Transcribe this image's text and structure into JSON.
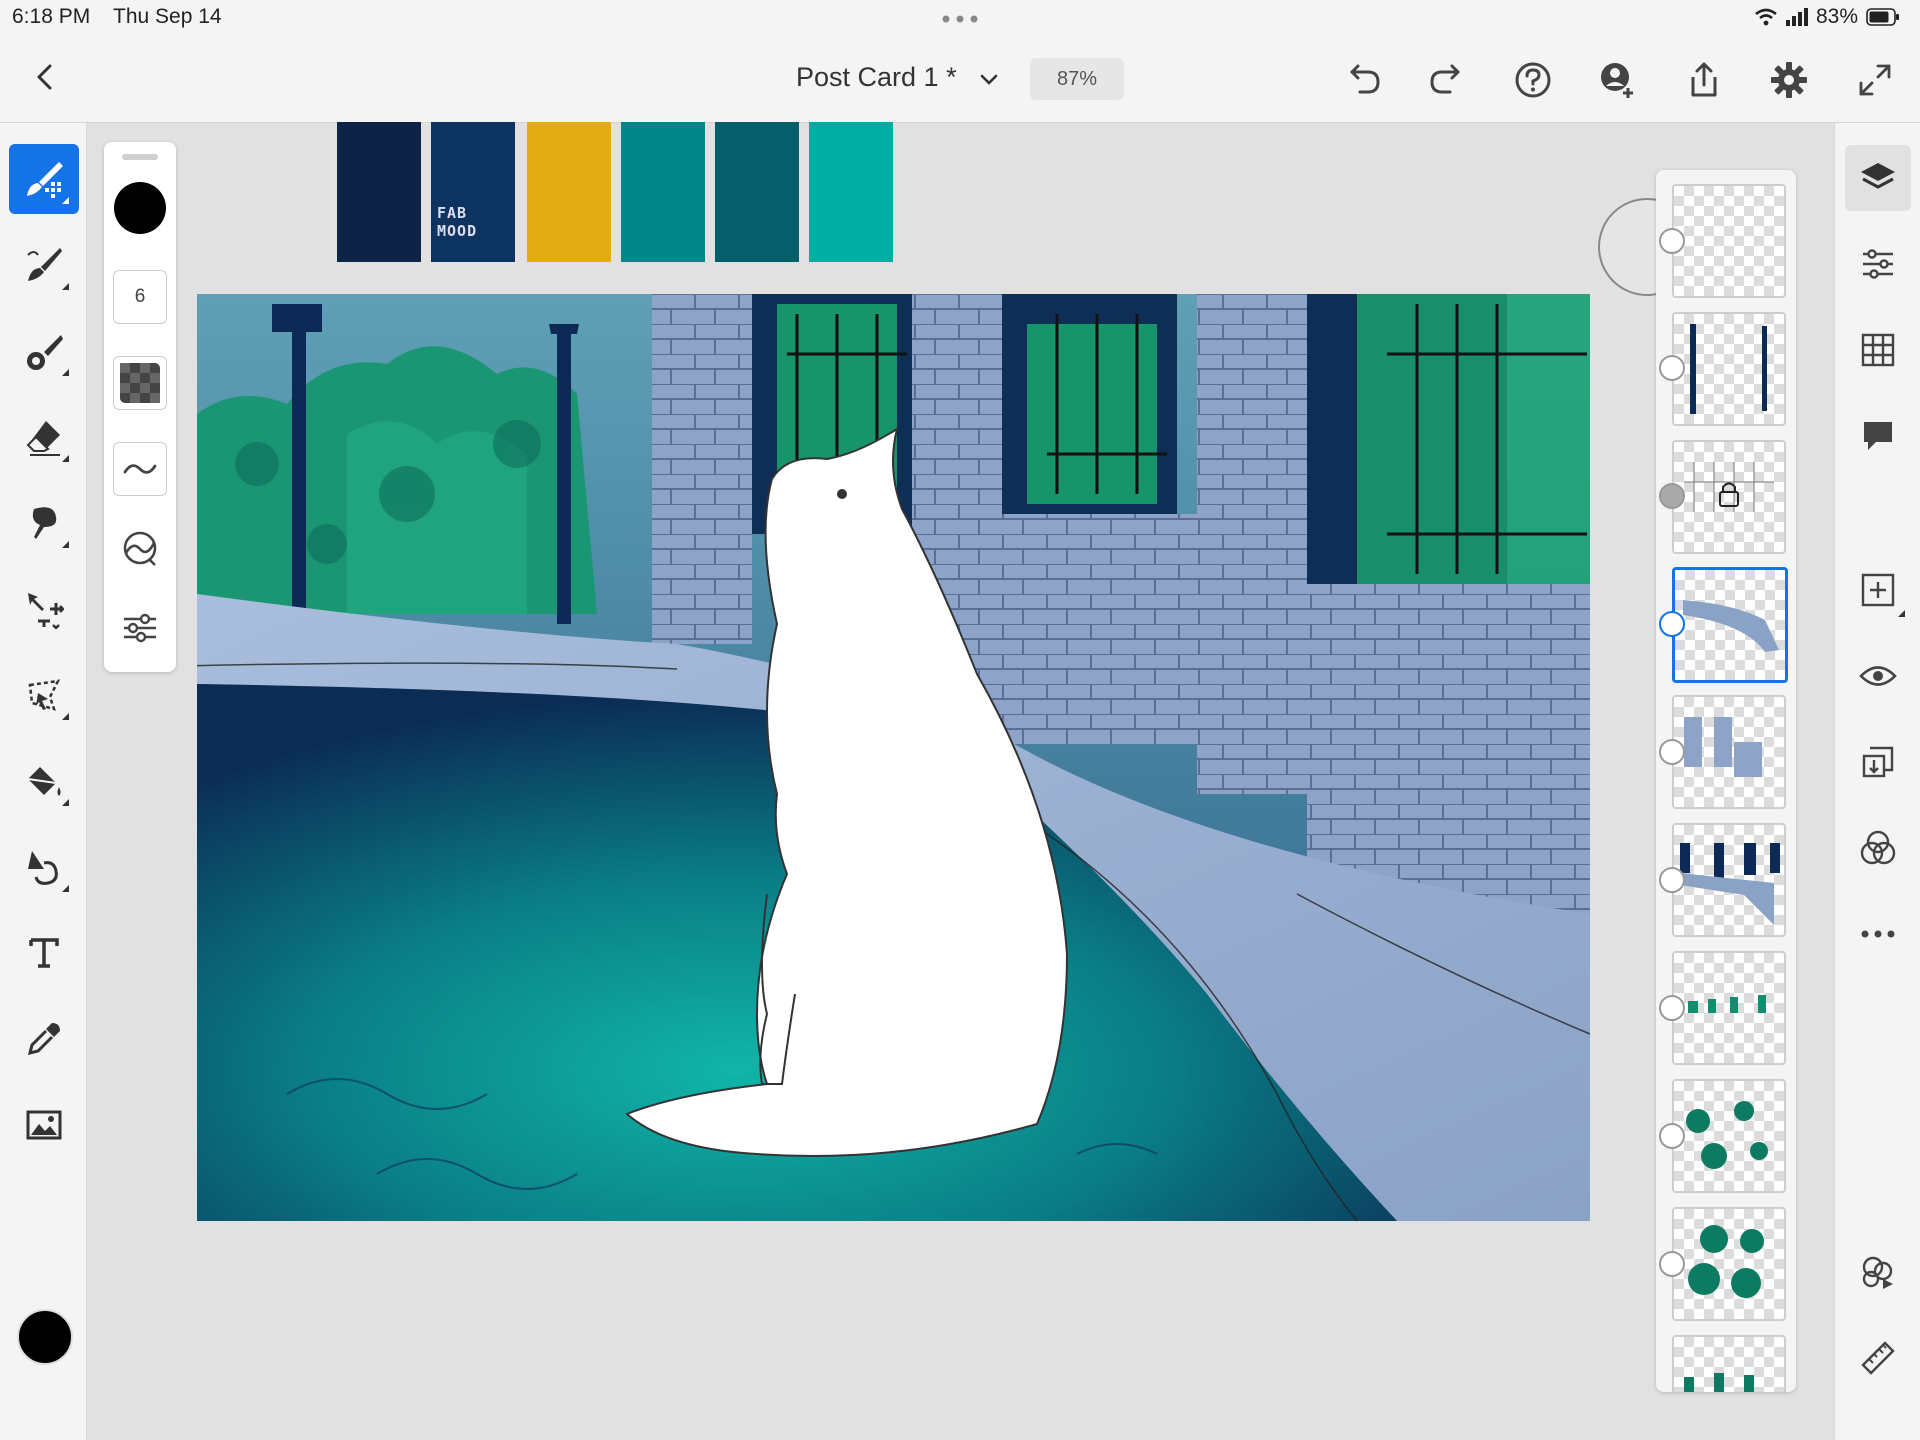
{
  "status": {
    "time": "6:18 PM",
    "date": "Thu Sep 14",
    "battery": "83%"
  },
  "document": {
    "title": "Post Card 1 *",
    "zoom": "87%"
  },
  "brush": {
    "size": "6"
  },
  "palette": {
    "swatches": [
      "#0d2447",
      "#0d3360",
      "#e3ab14",
      "#01878a",
      "#055f6b",
      "#00ada3"
    ],
    "swatch_text": "FAB MOOD"
  },
  "colors": {
    "accent": "#1473e6",
    "current_color": "#000000"
  },
  "toolbar_icons": [
    "undo-icon",
    "redo-icon",
    "help-icon",
    "invite-icon",
    "share-icon",
    "settings-icon",
    "fullscreen-icon"
  ],
  "left_tools": [
    "pixel-brush-icon",
    "live-brush-icon",
    "vector-brush-icon",
    "eraser-icon",
    "smudge-icon",
    "transform-icon",
    "lasso-icon",
    "fill-icon",
    "liquify-icon",
    "text-icon",
    "eyedropper-icon",
    "image-icon"
  ],
  "right_tools": [
    "layers-icon",
    "layer-properties-icon",
    "grid-icon",
    "comments-icon",
    "add-layer-icon",
    "visibility-icon",
    "merge-down-icon",
    "blend-mode-icon",
    "more-icon",
    "livestream-icon",
    "ruler-icon"
  ],
  "layers_count": 10
}
